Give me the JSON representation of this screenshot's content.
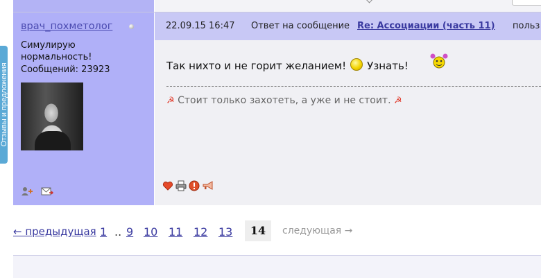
{
  "feedback": {
    "label": "Отзывы и предложения"
  },
  "post": {
    "author": {
      "name": "врач_похметолог",
      "status": "Симулирую нормальность!",
      "posts": "Сообщений: 23923"
    },
    "header": {
      "date": "22.09.15 16:47",
      "reply_prefix": "Ответ на сообщение",
      "reply_link": "Re: Ассоциации (часть 11)",
      "tail": "польз"
    },
    "body": {
      "text_before": "Так нихто и не горит желанием!",
      "text_after": "Узнать!"
    },
    "signature": {
      "text": "Стоит только захотеть, а уже и не стоит.",
      "symbol": "☭"
    },
    "actions": [
      "like-icon",
      "print-icon",
      "report-icon",
      "megaphone-icon"
    ]
  },
  "pagination": {
    "prev": "← предыдущая",
    "first": "1",
    "ellipsis": "..",
    "pages": [
      "9",
      "10",
      "11",
      "12",
      "13"
    ],
    "current": "14",
    "next": "следующая →"
  },
  "colors": {
    "author_bg": "#b0b0f8",
    "header_bg": "#c8c8f5",
    "content_bg": "#f0f0f4",
    "link": "#3a3aa0",
    "feedback_tab": "#5aa9d6"
  }
}
